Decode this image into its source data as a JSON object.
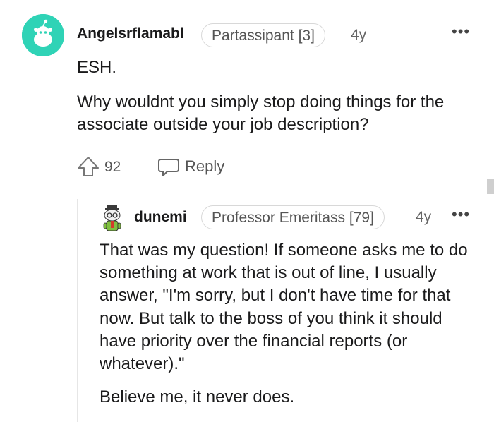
{
  "comment": {
    "author": "Angelsrflamabl",
    "flair": "Partassipant [3]",
    "age": "4y",
    "more": "•••",
    "paragraphs": [
      "ESH.",
      "Why wouldnt you simply stop doing things for the associate outside your job description?"
    ],
    "votes": "92",
    "reply_label": "Reply"
  },
  "reply": {
    "author": "dunemi",
    "flair": "Professor Emeritass [79]",
    "age": "4y",
    "more": "•••",
    "paragraphs": [
      "That was my question! If someone asks me to do something at work that is out of line, I usually answer, \"I'm sorry, but I don't have time for that now. But talk to the boss of you think it should have priority over the financial reports (or whatever).\"",
      "Believe me, it never does."
    ]
  },
  "colors": {
    "avatar1_bg": "#2fd3b6",
    "text": "#1a1a1b",
    "meta": "#555555",
    "thread_line": "#e6e6e6"
  }
}
